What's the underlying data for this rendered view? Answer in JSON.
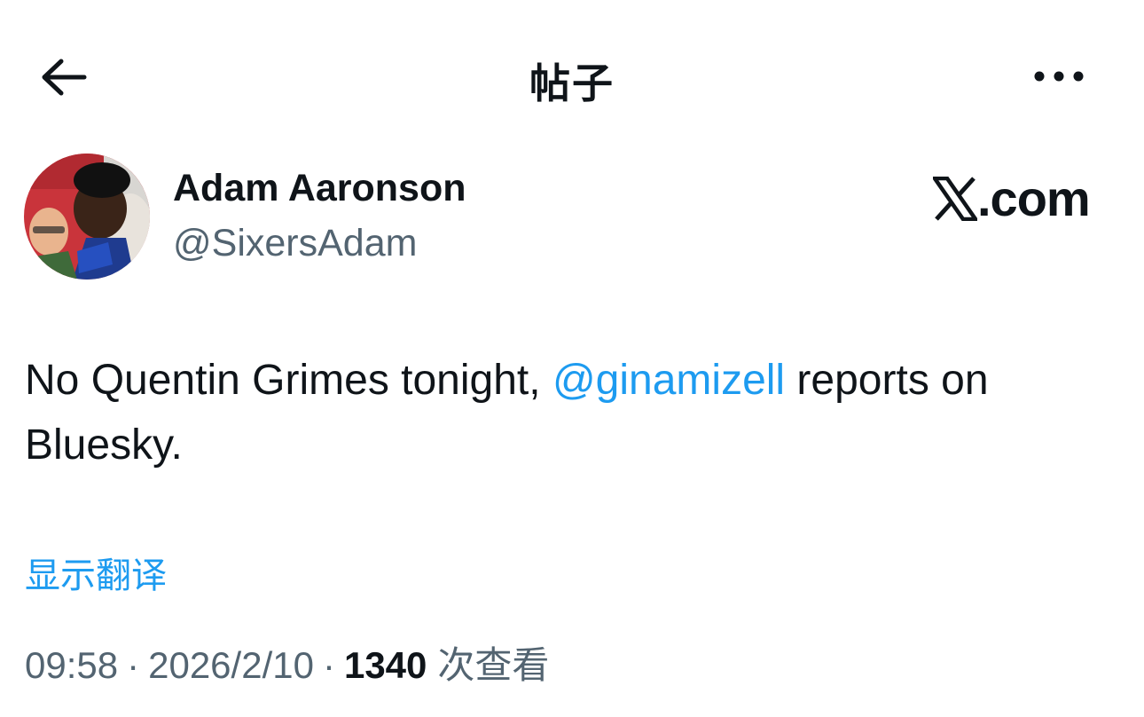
{
  "header": {
    "title": "帖子",
    "back_icon": "arrow-left-icon",
    "more_icon": "more-horizontal-icon"
  },
  "author": {
    "display_name": "Adam Aaronson",
    "handle": "@SixersAdam"
  },
  "watermark": {
    "text": ".com",
    "logo_icon": "x-logo-icon"
  },
  "tweet": {
    "text_before": "No Quentin Grimes tonight, ",
    "mention": "@ginamizell",
    "text_after": " reports on Bluesky."
  },
  "translate_label": "显示翻译",
  "meta": {
    "time": "09:58",
    "separator": "·",
    "date": "2026/2/10",
    "views_count": "1340",
    "views_label": "次查看"
  },
  "colors": {
    "text_primary": "#0f1419",
    "text_secondary": "#536471",
    "link": "#1d9bf0"
  }
}
